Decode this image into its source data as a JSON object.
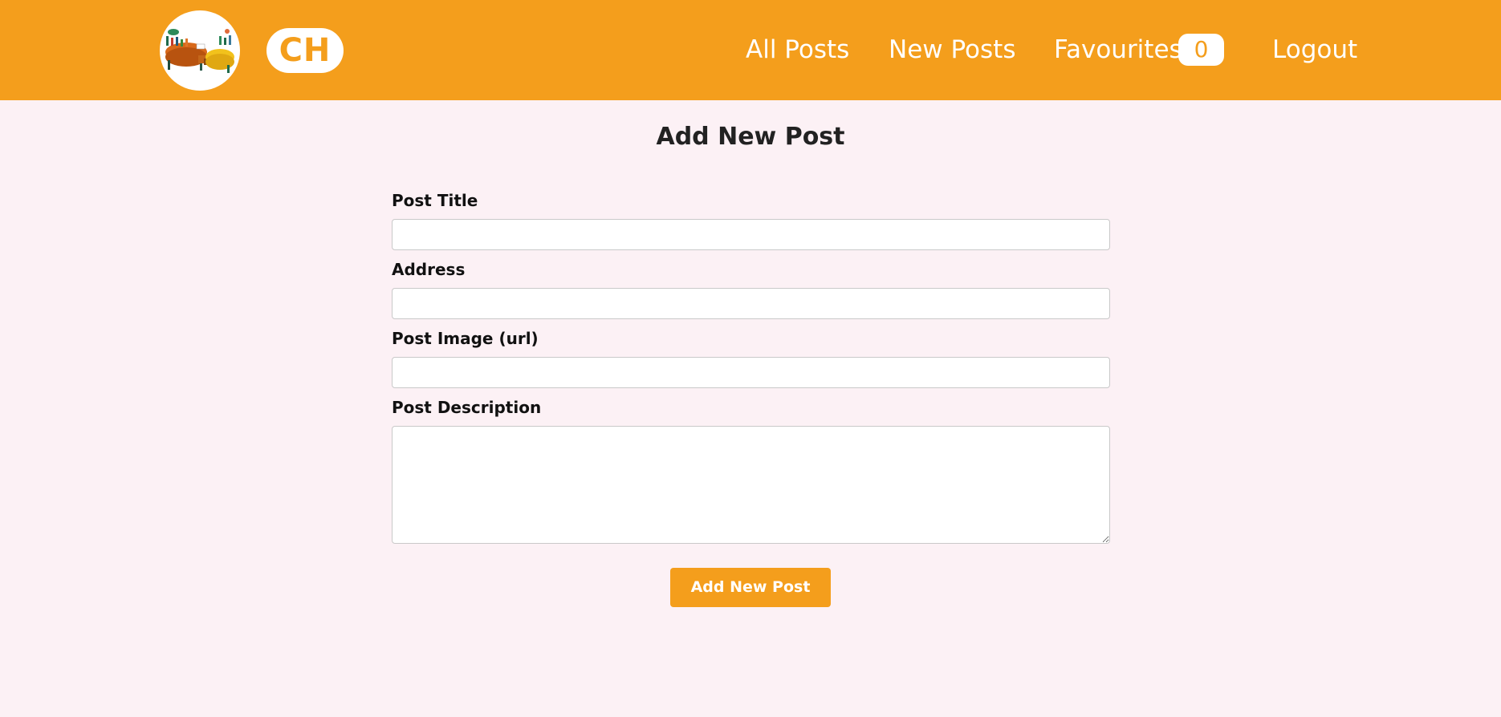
{
  "header": {
    "brand": "CH",
    "nav": {
      "all_posts": "All Posts",
      "new_posts": "New Posts",
      "favourites": "Favourites",
      "favourites_count": "0",
      "logout": "Logout"
    },
    "colors": {
      "bar": "#f49e1c",
      "text": "#ffffff"
    }
  },
  "form": {
    "title": "Add New Post",
    "fields": {
      "post_title": {
        "label": "Post Title",
        "value": ""
      },
      "address": {
        "label": "Address",
        "value": ""
      },
      "post_image": {
        "label": "Post Image (url)",
        "value": ""
      },
      "post_description": {
        "label": "Post Description",
        "value": ""
      }
    },
    "submit_label": "Add New Post"
  },
  "icons": {
    "logo": "community-people-logo-icon"
  }
}
